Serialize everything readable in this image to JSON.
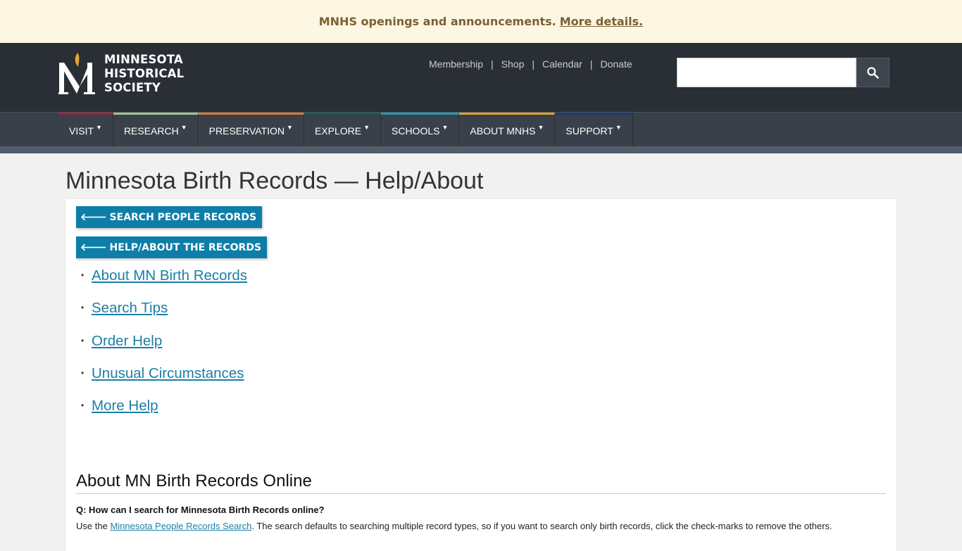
{
  "announcement": {
    "text": "MNHS openings and announcements.",
    "link_label": "More details."
  },
  "header": {
    "logo_lines": [
      "MINNESOTA",
      "HISTORICAL",
      "SOCIETY"
    ],
    "utility_links": [
      "Membership",
      "Shop",
      "Calendar",
      "Donate"
    ],
    "search": {
      "value": "",
      "placeholder": "",
      "button_icon": "search-icon"
    }
  },
  "nav": {
    "items": [
      {
        "label": "VISIT",
        "color": "#9b2335"
      },
      {
        "label": "RESEARCH",
        "color": "#9fc58f"
      },
      {
        "label": "PRESERVATION",
        "color": "#d97a34"
      },
      {
        "label": "EXPLORE",
        "color": "#1d5a54"
      },
      {
        "label": "SCHOOLS",
        "color": "#1f9fb2"
      },
      {
        "label": "ABOUT MNHS",
        "color": "#e0a52a"
      },
      {
        "label": "SUPPORT",
        "color": "#1e3a6e"
      }
    ]
  },
  "page": {
    "title": "Minnesota Birth Records — Help/About",
    "buttons": [
      {
        "label": "SEARCH PEOPLE RECORDS",
        "icon": "arrow-left-icon"
      },
      {
        "label": "HELP/ABOUT THE RECORDS",
        "icon": "arrow-left-icon"
      }
    ],
    "links": [
      "About MN Birth Records",
      "Search Tips",
      "Order Help",
      "Unusual Circumstances",
      "More Help"
    ],
    "section": {
      "title": "About MN Birth Records Online",
      "question": "Q: How can I search for Minnesota Birth Records online?",
      "answer_prefix": "Use the",
      "answer_link": "Minnesota People Records Search",
      "answer_suffix": ".  The search defaults to searching multiple record types, so if you want to search only birth records, click the check-marks to remove the others."
    }
  },
  "colors": {
    "accent_blue": "#0d7ea8",
    "link_blue": "#1a7fa6",
    "header_bg": "#2a2f36",
    "announcement_bg": "#fdf6e3"
  }
}
